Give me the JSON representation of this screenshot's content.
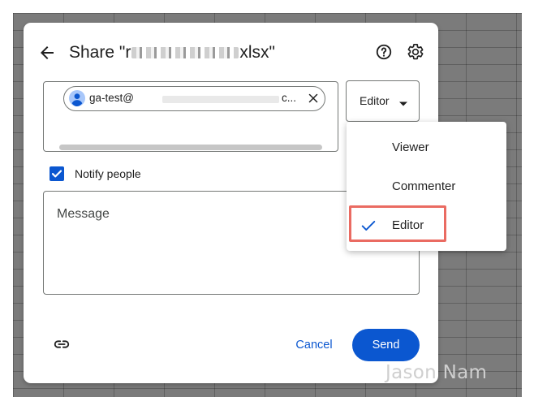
{
  "dialog": {
    "title_prefix": "Share \"r",
    "title_suffix": "xlsx\""
  },
  "recipient": {
    "email_prefix": "ga-test@",
    "email_suffix": "c...",
    "avatar_icon": "person-icon",
    "remove_icon": "close-icon"
  },
  "role_select": {
    "value": "Editor",
    "caret_icon": "arrow-drop-down-icon"
  },
  "notify": {
    "label": "Notify people",
    "checked": true
  },
  "message": {
    "placeholder": "Message"
  },
  "footer": {
    "cancel_label": "Cancel",
    "send_label": "Send",
    "link_icon": "link-icon"
  },
  "role_menu": {
    "items": [
      {
        "label": "Viewer",
        "selected": false
      },
      {
        "label": "Commenter",
        "selected": false
      },
      {
        "label": "Editor",
        "selected": true
      }
    ]
  },
  "header_icons": [
    "back-arrow-icon",
    "help-icon",
    "settings-icon"
  ],
  "watermark": "Jason Nam",
  "colors": {
    "accent": "#0b57d0",
    "highlight_border": "#ea6b62",
    "backdrop": "#7b7b7b"
  }
}
